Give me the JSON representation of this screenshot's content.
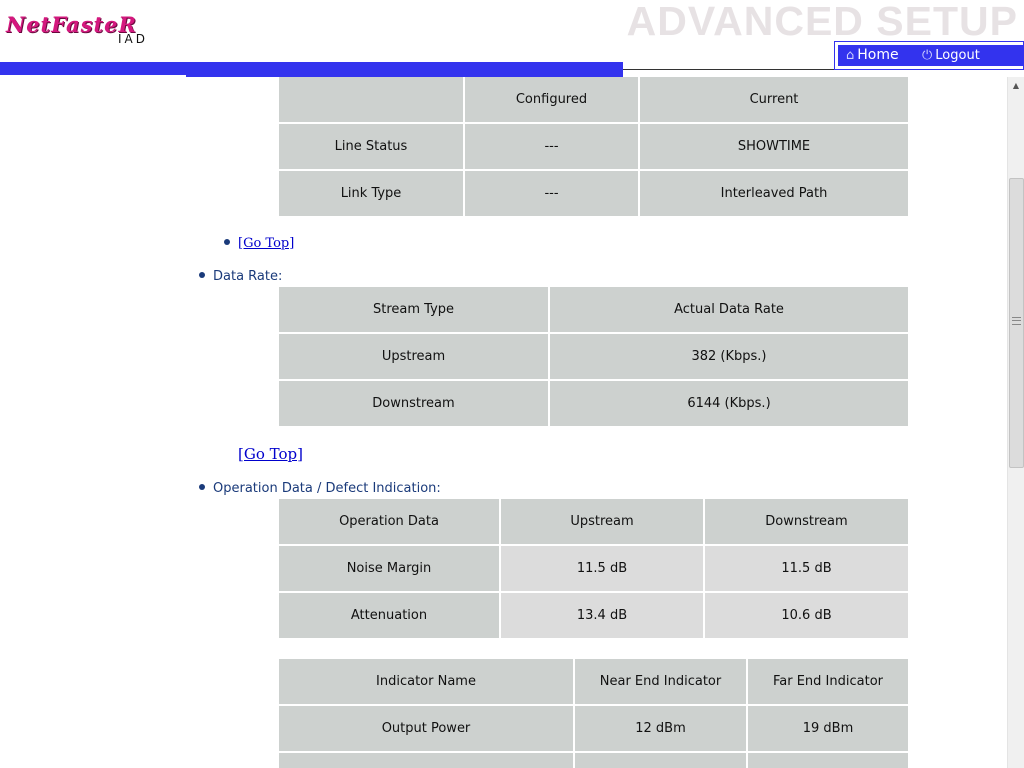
{
  "header": {
    "logo_main": "NetFasteR",
    "logo_sub": "IAD",
    "banner_title": "ADVANCED SETUP",
    "nav": [
      {
        "label": "Home",
        "icon": "home-icon"
      },
      {
        "label": "Logout",
        "icon": "power-icon"
      }
    ]
  },
  "colors": {
    "accent": "#3333ee",
    "logo": "#d4187e",
    "cell": "#cdd1cf",
    "cell_light": "#dcdcdc",
    "link": "#0000cc"
  },
  "status_table": {
    "headers": [
      "",
      "Configured",
      "Current"
    ],
    "rows": [
      [
        "Line Status",
        "---",
        "SHOWTIME"
      ],
      [
        "Link Type",
        "---",
        "Interleaved Path"
      ]
    ]
  },
  "go_top_1": "[Go Top]",
  "data_rate": {
    "heading": "Data Rate:",
    "headers": [
      "Stream Type",
      "Actual Data Rate"
    ],
    "rows": [
      [
        "Upstream",
        "382 (Kbps.)"
      ],
      [
        "Downstream",
        "6144 (Kbps.)"
      ]
    ]
  },
  "go_top_2": "[Go Top]",
  "operation": {
    "heading": "Operation Data / Defect Indication:",
    "headers": [
      "Operation Data",
      "Upstream",
      "Downstream"
    ],
    "rows": [
      [
        "Noise Margin",
        "11.5 dB",
        "11.5 dB"
      ],
      [
        "Attenuation",
        "13.4 dB",
        "10.6 dB"
      ]
    ]
  },
  "indicator": {
    "headers": [
      "Indicator Name",
      "Near End Indicator",
      "Far End Indicator"
    ],
    "rows": [
      [
        "Output Power",
        "12 dBm",
        "19 dBm"
      ],
      [
        "",
        "",
        ""
      ]
    ]
  }
}
